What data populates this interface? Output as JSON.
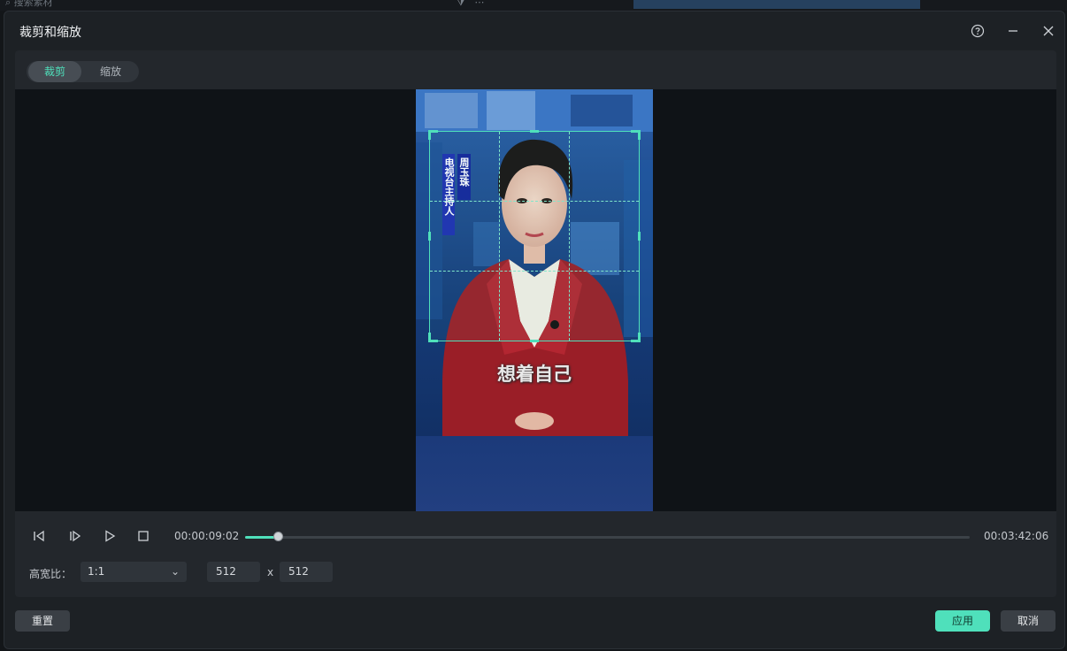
{
  "background": {
    "search_placeholder": "搜索素材"
  },
  "dialog": {
    "title": "裁剪和缩放",
    "help_icon": "help-circle-icon",
    "minimize_icon": "minimize-icon",
    "close_icon": "close-icon"
  },
  "tabs": [
    {
      "label": "裁剪",
      "active": true
    },
    {
      "label": "缩放",
      "active": false
    }
  ],
  "video": {
    "lower_third_line1": "周玉珠",
    "lower_third_line2": "电视台主持人",
    "caption": "想着自己"
  },
  "playback": {
    "current_time": "00:00:09:02",
    "total_time": "00:03:42:06",
    "progress_fraction": 0.045
  },
  "crop": {
    "ratio_label": "高宽比：",
    "ratio_value": "1:1",
    "width": "512",
    "times_sign": "x",
    "height": "512"
  },
  "footer": {
    "reset_label": "重置",
    "apply_label": "应用",
    "cancel_label": "取消"
  },
  "colors": {
    "accent": "#4fe0bb",
    "dialog_bg": "#1d2125",
    "panel_bg": "#23272c",
    "preview_bg": "#0f1317"
  }
}
